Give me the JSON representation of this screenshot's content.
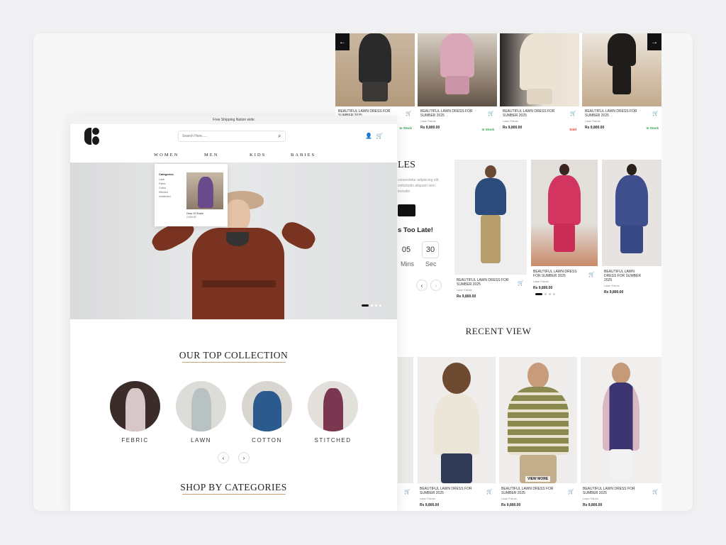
{
  "colors": {
    "brand": "#111111",
    "in_stock": "#2e9c4f",
    "sold": "#d8322c",
    "accent_line": "#c9a27a"
  },
  "top_products": [
    {
      "name": "BEAUTIFUL LAWN DRESS FOR SUMBER 2025",
      "sub": "",
      "price": "",
      "status": "In Stock"
    },
    {
      "name": "BEAUTIFUL LAWN DRESS FOR SUMBER 2025",
      "sub": "Lawn Fabric",
      "price": "Rs 9,800.00",
      "status": "In Stock"
    },
    {
      "name": "BEAUTIFUL LAWN DRESS FOR SUMBER 2025",
      "sub": "Lawn Fabric",
      "price": "Rs 9,800.00",
      "status": "Sold"
    },
    {
      "name": "BEAUTIFUL LAWN DRESS FOR SUMBER 2025",
      "sub": "Lawn Fabric",
      "price": "Rs 9,800.00",
      "status": "In Stock"
    }
  ],
  "sale": {
    "title_fragment": "LES",
    "desc": "consectetur adipiscing elit. sollicitudin aliquam sem. lectudin",
    "timer_text": "s Too Late!",
    "minutes": "05",
    "seconds": "30",
    "mins_label": "Mins",
    "sec_label": "Sec"
  },
  "sale_products": [
    {
      "name": "BEAUTIFUL LAWN DRESS FOR SUMBER 2025",
      "sub": "Lawn Fabric",
      "price": "Rs 9,800.00"
    },
    {
      "name": "BEAUTIFUL LAWN DRESS FOR SUMBER 2025",
      "sub": "Lawn Fabric",
      "price": "Rs 9,800.00"
    },
    {
      "name": "BEAUTIFUL LAWN DRESS FOR SUMBER 2025",
      "sub": "Lawn Fabric",
      "price": "Rs 9,800.00"
    }
  ],
  "recent": {
    "title": "RECENT VIEW",
    "view_more": "VIEW MORE",
    "items": [
      {
        "name": "BEAUTIFUL LAWN DRESS FOR SUMBER 2025",
        "sub": "Lawn Fabric",
        "price": "Rs 9,800.00"
      },
      {
        "name": "BEAUTIFUL LAWN DRESS FOR SUMBER 2025",
        "sub": "Lawn Fabric",
        "price": "Rs 9,800.00"
      },
      {
        "name": "BEAUTIFUL LAWN DRESS FOR SUMBER 2025",
        "sub": "Lawn Fabric",
        "price": "Rs 9,800.00"
      }
    ]
  },
  "front": {
    "topbar": "Free Shipping Nation wide",
    "search_placeholder": "Search Here.....",
    "nav": [
      "WOMEN",
      "MEN",
      "KIDS",
      "BABIES"
    ],
    "dropdown": {
      "title": "Categories",
      "items": [
        "Lawn",
        "Fabric",
        "Cotton",
        "Stitched",
        "Unstitched"
      ],
      "caption": "Deep Of Shade",
      "caption_price": "2,500.00"
    },
    "collection_title": "OUR TOP COLLECTION",
    "collections": [
      "FEBRIC",
      "LAWN",
      "COTTON",
      "STITCHED"
    ],
    "categories_title": "SHOP BY CATEGORIES"
  },
  "icons": {
    "prev": "arrow-left-icon",
    "next": "arrow-right-icon",
    "cart": "cart-icon",
    "user": "user-icon",
    "search": "search-icon"
  }
}
